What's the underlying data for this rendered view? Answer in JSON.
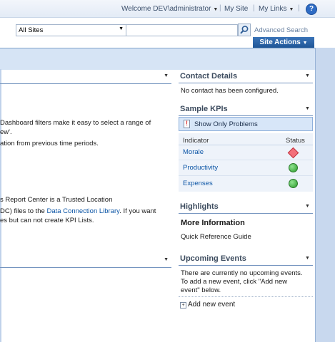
{
  "topbar": {
    "welcome": "Welcome DEV\\administrator",
    "my_site": "My Site",
    "my_links": "My Links",
    "help": "?"
  },
  "search": {
    "scope": "All Sites",
    "query": "",
    "advanced": "Advanced Search"
  },
  "site_actions": "Site Actions",
  "left": {
    "lines": [
      "Dashboard filters make it easy to select a range of",
      "ew'.",
      "ation from previous time periods.",
      "s Report Center is a Trusted Location",
      "DC) files to the",
      "Data Connection Library",
      ". If you want",
      "es but can not create KPI Lists."
    ]
  },
  "contact": {
    "title": "Contact Details",
    "text": "No contact has been configured."
  },
  "kpis": {
    "title": "Sample KPIs",
    "filter_button": "Show Only Problems",
    "col_indicator": "Indicator",
    "col_status": "Status",
    "rows": [
      {
        "name": "Morale",
        "status": "red-diamond"
      },
      {
        "name": "Productivity",
        "status": "green-circle"
      },
      {
        "name": "Expenses",
        "status": "green-circle"
      }
    ]
  },
  "highlights": {
    "title": "Highlights",
    "subtitle": "More Information",
    "link": "Quick Reference Guide"
  },
  "events": {
    "title": "Upcoming Events",
    "line1": "There are currently no upcoming events.",
    "line2": "To add a new event, click \"Add new",
    "line3": "event\" below.",
    "add": "Add new event"
  },
  "colors": {
    "accent": "#1f5697",
    "link": "#0d56a6",
    "band": "#d6e4f5",
    "status_good": "#2b9a2b",
    "status_bad": "#f36f7a"
  }
}
